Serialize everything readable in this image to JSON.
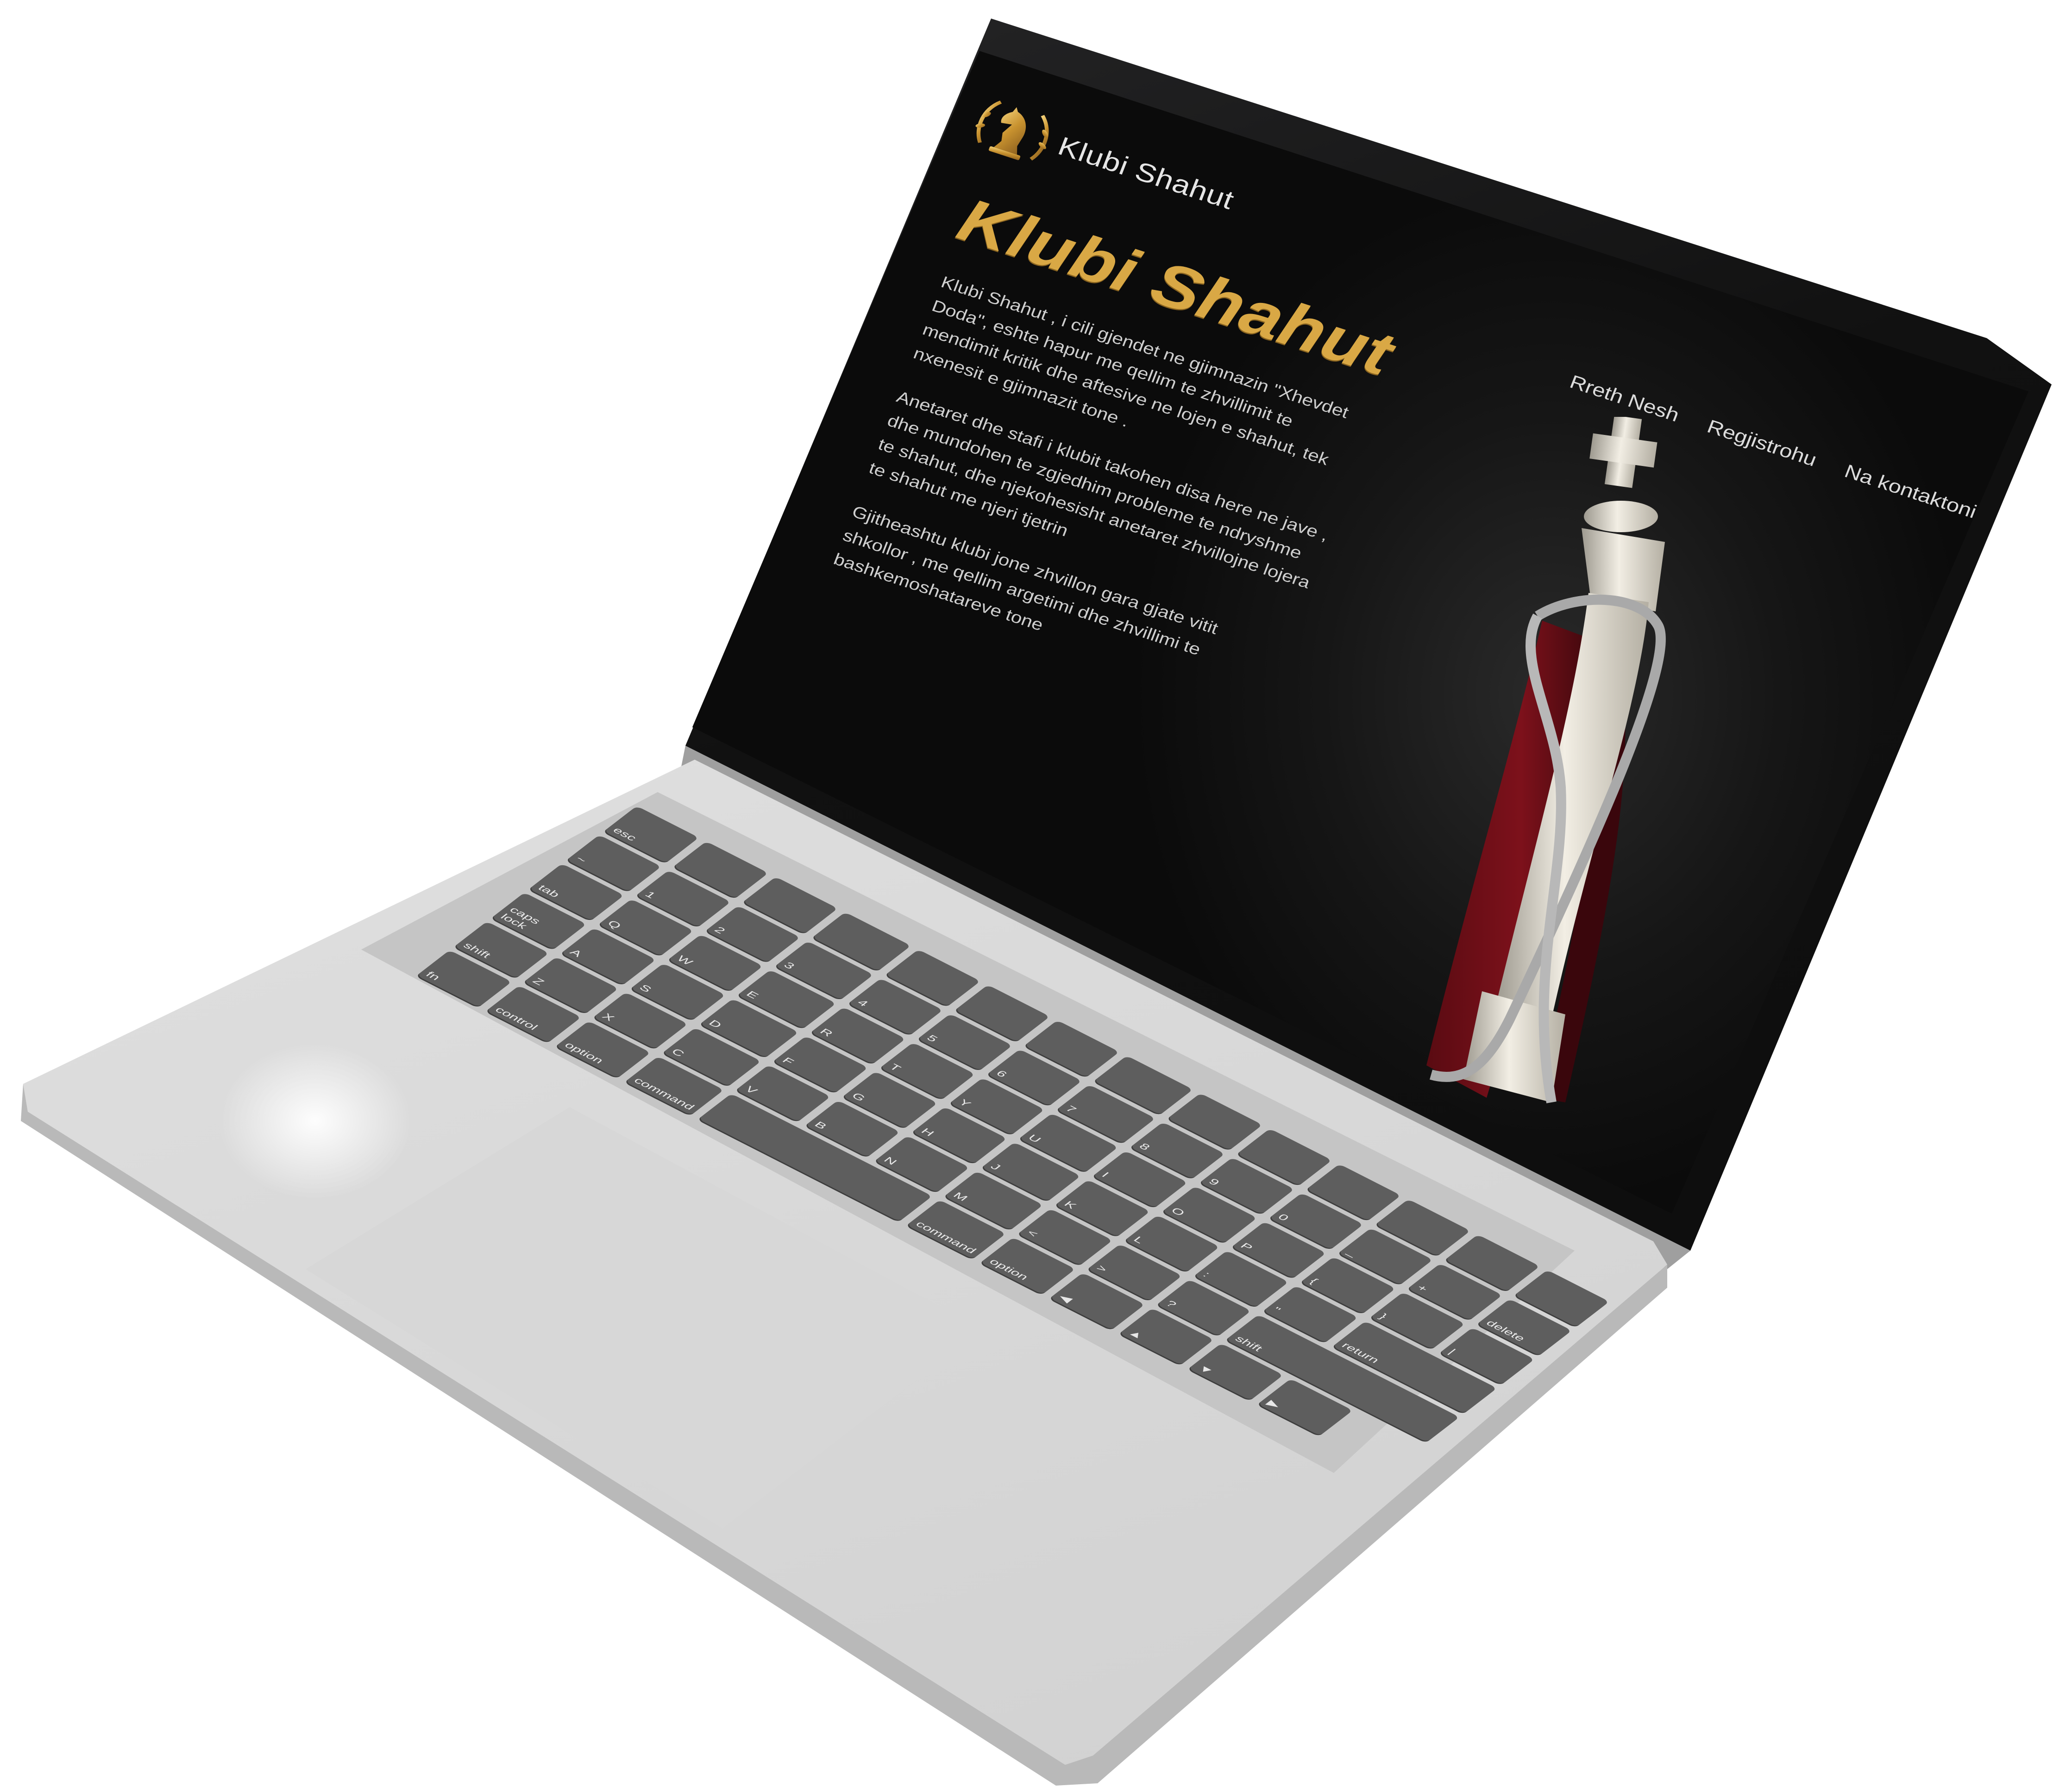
{
  "site": {
    "brand": "Klubi Shahut",
    "nav": [
      "Rreth Nesh",
      "Regjistrohu",
      "Na kontaktoni"
    ],
    "hero_title": "Klubi Shahut",
    "paragraphs": [
      "Klubi Shahut , i cili gjendet ne gjimnazin \"Xhevdet Doda\", eshte hapur me qellim te zhvillimit te mendimit kritik dhe aftesive ne lojen e shahut, tek nxenesit e gjimnazit tone .",
      "Anetaret dhe stafi i klubit takohen disa here ne jave , dhe mundohen te zgjedhim probleme te ndryshme te shahut, dhe njekohesisht anetaret zhvillojne lojera te shahut me njeri tjetrin",
      "Gjitheashtu klubi jone zhvillon gara gjate vitit shkollor , me qellim argetimi dhe zhvillimi te bashkemoshatareve tone"
    ]
  },
  "colors": {
    "gold": "#d9a845",
    "screen_bg": "#0b0b0b",
    "key": "#5e5e5e",
    "chassis": "#dcdcdc"
  },
  "icons": {
    "logo": "chess-knight-laurel-icon",
    "hero_image": "chess-king-icon"
  },
  "keyboard": {
    "rows": [
      [
        "esc",
        "",
        "",
        "",
        "",
        "",
        "",
        "",
        "",
        "",
        "",
        "",
        "",
        ""
      ],
      [
        "~",
        "1",
        "2",
        "3",
        "4",
        "5",
        "6",
        "7",
        "8",
        "9",
        "0",
        "_",
        "+",
        "delete"
      ],
      [
        "tab",
        "Q",
        "W",
        "E",
        "R",
        "T",
        "Y",
        "U",
        "I",
        "O",
        "P",
        "{",
        "}",
        "|"
      ],
      [
        "caps lock",
        "A",
        "S",
        "D",
        "F",
        "G",
        "H",
        "J",
        "K",
        "L",
        ":",
        "\"",
        "return",
        ""
      ],
      [
        "shift",
        "Z",
        "X",
        "C",
        "V",
        "B",
        "N",
        "M",
        "<",
        ">",
        "?",
        "shift",
        "",
        ""
      ],
      [
        "fn",
        "control",
        "option",
        "command",
        "",
        "",
        "",
        "command",
        "option",
        "◀",
        "▲",
        "▼",
        "▶",
        ""
      ]
    ]
  }
}
